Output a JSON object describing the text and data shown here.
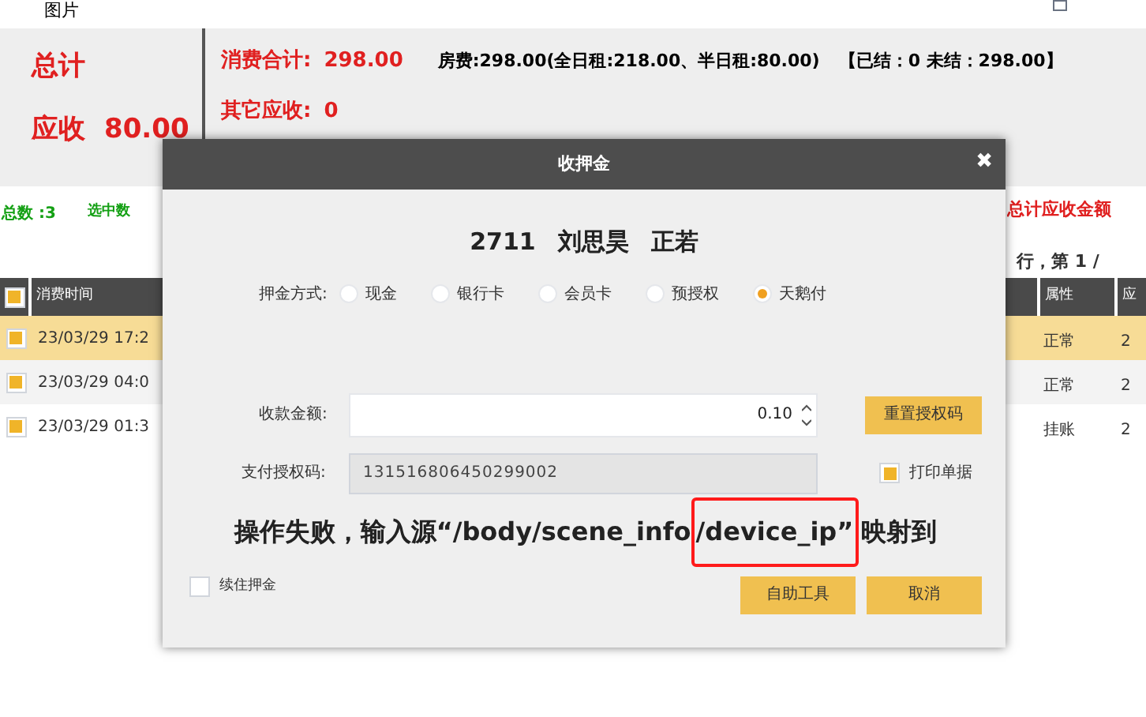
{
  "window": {
    "title": "图片"
  },
  "summary": {
    "total_label": "总计",
    "receivable_label": "应收",
    "receivable_value": "80.00",
    "consumption_label": "消费合计:",
    "consumption_value": "298.00",
    "room_fee": "房费:298.00(全日租:218.00、半日租:80.00)",
    "settlement": "【已结：0 未结：298.00】",
    "other_label": "其它应收:",
    "other_value": "0"
  },
  "list_bar": {
    "count": "总数 :3",
    "selected": "选中数",
    "total_receivable": "总计应收金额",
    "pager": "行，第 1 /"
  },
  "table": {
    "header_checked": true,
    "columns": {
      "time": "消费时间",
      "attribute": "属性",
      "column_4": "应"
    },
    "rows": [
      {
        "selected": true,
        "checked": true,
        "time": "23/03/29 17:2",
        "attribute": "正常",
        "column_4": "2"
      },
      {
        "selected": false,
        "checked": true,
        "time": "23/03/29 04:0",
        "attribute": "正常",
        "column_4": "2"
      },
      {
        "selected": false,
        "checked": true,
        "time": "23/03/29 01:3",
        "attribute": "挂账",
        "column_4": "2"
      }
    ]
  },
  "dialog": {
    "title": "收押金",
    "close": "✖",
    "room": "2711",
    "guest": "刘思昊",
    "guest_2": "正若",
    "method_label": "押金方式:",
    "methods": [
      {
        "label": "现金",
        "selected": false
      },
      {
        "label": "银行卡",
        "selected": false
      },
      {
        "label": "会员卡",
        "selected": false
      },
      {
        "label": "预授权",
        "selected": false
      },
      {
        "label": "天鹅付",
        "selected": true
      }
    ],
    "amount_label": "收款金额:",
    "amount": "0.10",
    "reset_button": "重置授权码",
    "auth_label": "支付授权码:",
    "auth_code": "131516806450299002",
    "print": {
      "label": "打印单据",
      "checked": true
    },
    "message": {
      "before": "操作失败，输入源“/body/scene_info",
      "highlighted": "/device_ip”",
      "after": "映射到"
    },
    "renew": {
      "label": "续住押金",
      "checked": false
    },
    "buttons": [
      "自助工具",
      "取消"
    ]
  }
}
